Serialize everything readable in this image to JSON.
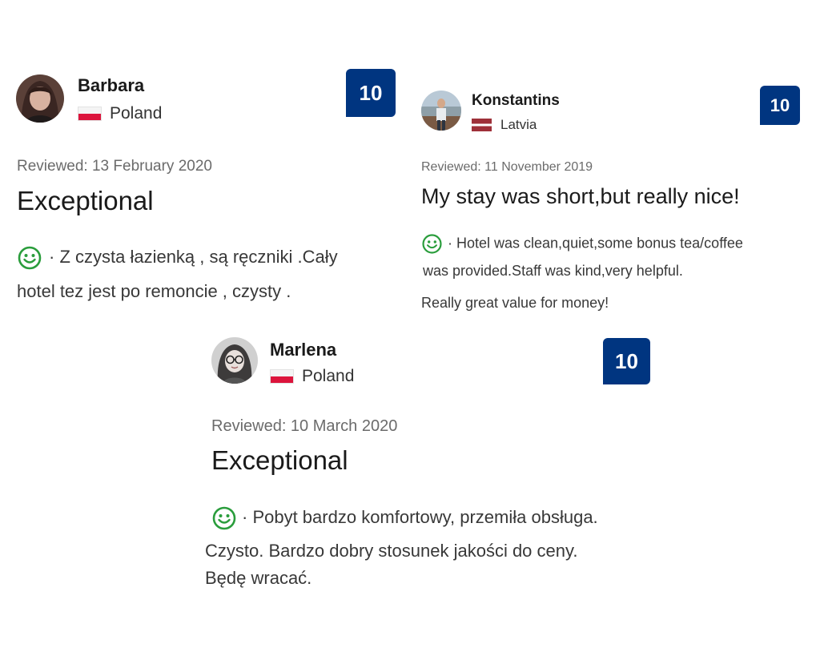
{
  "reviews": [
    {
      "name": "Barbara",
      "country": "Poland",
      "score": "10",
      "reviewed": "Reviewed: 13 February 2020",
      "title": "Exceptional",
      "text_line1": "·  Z czysta łazienką , są ręczniki .Cały",
      "text_line2": "hotel tez jest po remoncie , czysty ."
    },
    {
      "name": "Konstantins",
      "country": "Latvia",
      "score": "10",
      "reviewed": "Reviewed: 11 November 2019",
      "title": "My stay was short,but really nice!",
      "text_line1": "·  Hotel was clean,quiet,some bonus tea/coffee",
      "text_line2": "was provided.Staff was kind,very helpful.",
      "text_line3": "Really great value for money!"
    },
    {
      "name": "Marlena",
      "country": "Poland",
      "score": "10",
      "reviewed": "Reviewed: 10 March 2020",
      "title": "Exceptional",
      "text_line1": "· Pobyt bardzo komfortowy, przemiła obsługa.",
      "text_line2": "Czysto. Bardzo dobry stosunek jakości do  ceny.",
      "text_line3": "Będę wracać."
    }
  ],
  "colors": {
    "score_bg": "#003580",
    "smile": "#2a9d3c"
  },
  "icons": {
    "positive": "smiley-face-icon",
    "flag_poland": "poland-flag-icon",
    "flag_latvia": "latvia-flag-icon"
  }
}
